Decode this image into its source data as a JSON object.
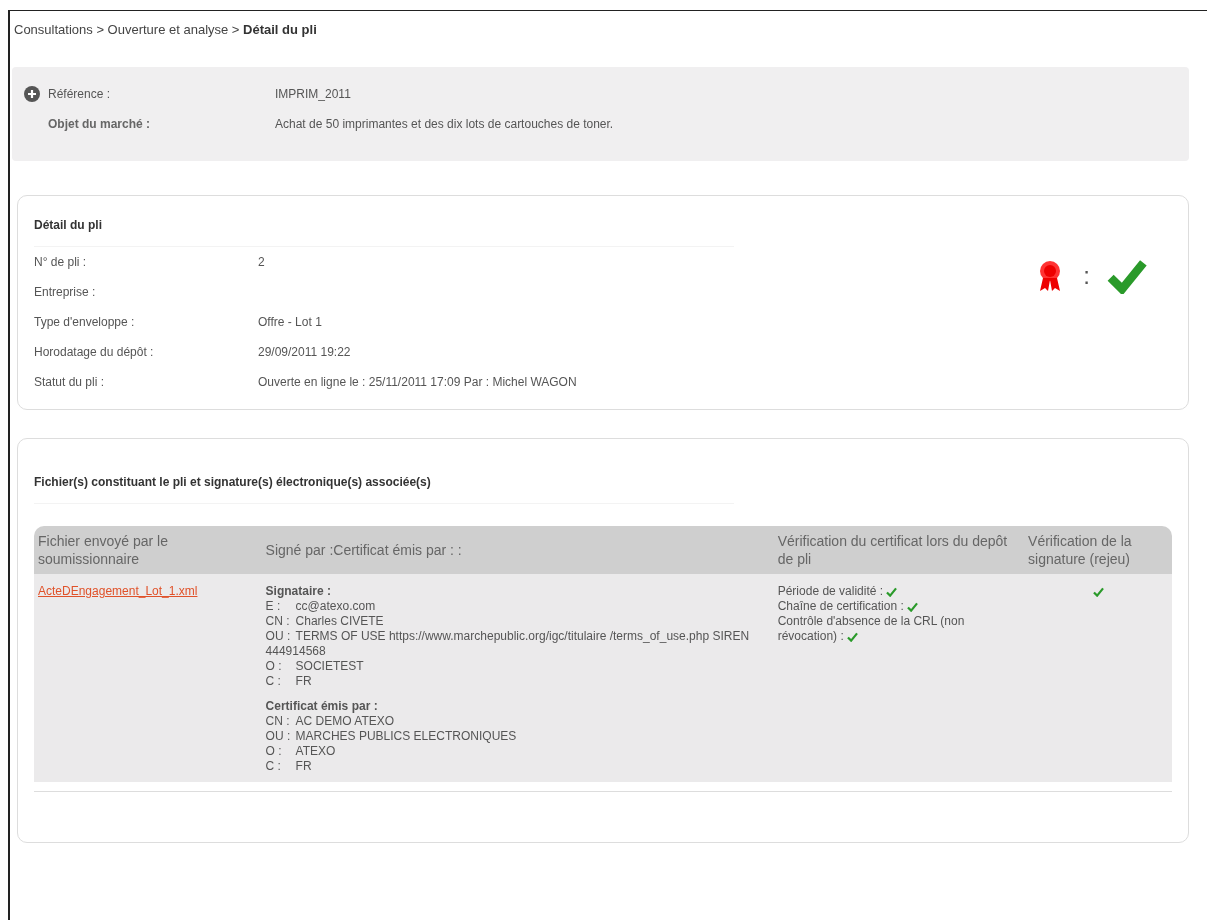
{
  "breadcrumb": "Consultations > Ouverture et analyse  > **Détail du pli**",
  "summary": {
    "expanded": false,
    "fields": [
      {
        "label": "Référence :",
        "value": "IMPRIM_2011"
      },
      {
        "label": "Objet du marché :",
        "value": "Achat de 50 imprimantes et des dix lots de cartouches de toner."
      }
    ]
  },
  "detail": {
    "title": "Détail du pli",
    "certificate_valid": true,
    "separator": ":",
    "fields": [
      {
        "label": "N° de pli :",
        "value": "2"
      },
      {
        "label": "Entreprise :"
      },
      {
        "label": "Type d'enveloppe :",
        "value": "Offre - Lot 1"
      },
      {
        "label": "Horodatage du dépôt :",
        "value": "29/09/2011 19:22"
      },
      {
        "label": "Statut du pli :",
        "value": "Ouverte en ligne le : 25/11/2011 17:09 Par : Michel WAGON"
      }
    ]
  },
  "files": {
    "title": "Fichier(s) constituant le pli et signature(s) électronique(s) associée(s)",
    "columns": [
      "Fichier envoyé par le soumissionnaire",
      "Signé par :Certificat émis par : :",
      "Vérification du certificat lors du depôt de pli",
      "Vérification de la signature (rejeu)"
    ],
    "rows": [
      {
        "file": "ActeDEngagement_Lot_1.xml",
        "signer_title": "Signataire :",
        "signer": [
          {
            "key": "E :",
            "value": "cc@atexo.com"
          },
          {
            "key": "CN :",
            "value": "Charles CIVETE"
          },
          {
            "key": "OU :",
            "value": "TERMS OF USE https://www.marchepublic.org/igc/titulaire /terms_of_use.php SIREN 444914568"
          },
          {
            "key": "O :",
            "value": "SOCIETEST"
          },
          {
            "key": "C :",
            "value": "FR"
          }
        ],
        "issuer_title": "Certificat émis par :",
        "issuer": [
          {
            "key": "CN :",
            "value": "AC DEMO ATEXO"
          },
          {
            "key": "OU :",
            "value": "MARCHES PUBLICS ELECTRONIQUES"
          },
          {
            "key": "O :",
            "value": "ATEXO"
          },
          {
            "key": "C :",
            "value": "FR"
          }
        ],
        "checks": [
          {
            "label": "Période de validité :",
            "ok": true
          },
          {
            "label": "Chaîne de certification :",
            "ok": true
          },
          {
            "label": "Contrôle d'absence de la CRL (non révocation) :",
            "ok": true
          }
        ],
        "replay_ok": true
      }
    ]
  }
}
